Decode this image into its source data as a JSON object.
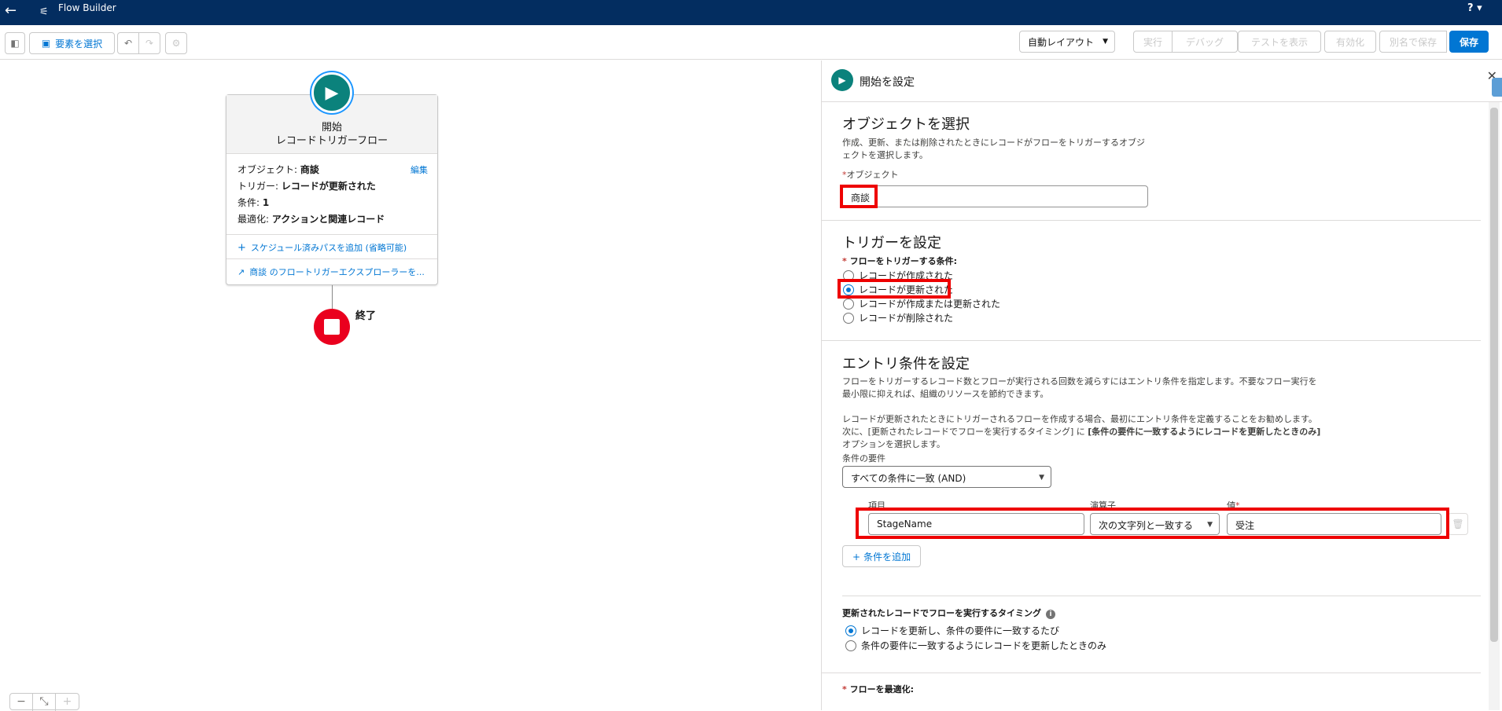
{
  "topbar": {
    "back_icon": "←",
    "title": "Flow Builder",
    "help": "? ▾"
  },
  "toolbar": {
    "select_elements": "要素を選択",
    "auto_layout": "自動レイアウト",
    "run": "実行",
    "debug": "デバッグ",
    "view_tests": "テストを表示",
    "activate": "有効化",
    "save_as": "別名で保存",
    "save": "保存"
  },
  "canvas": {
    "start_title": "開始",
    "start_subtitle": "レコードトリガーフロー",
    "object_label": "オブジェクト:",
    "object_value": "商談",
    "edit_link": "編集",
    "trigger_label": "トリガー:",
    "trigger_value": "レコードが更新された",
    "conditions_label": "条件:",
    "conditions_value": "1",
    "optimize_label": "最適化:",
    "optimize_value": "アクションと関連レコード",
    "add_scheduled_path": "スケジュール済みパスを追加 (省略可能)",
    "explorer_link": "商談 のフロートリガーエクスプローラーを...",
    "end_label": "終了"
  },
  "panel": {
    "title": "開始を設定",
    "object_section": {
      "heading": "オブジェクトを選択",
      "description_line1": "作成、更新、または削除されたときにレコードがフローをトリガーするオブジ",
      "description_line2": "ェクトを選択します。",
      "field_label": "オブジェクト",
      "field_value": "商談"
    },
    "trigger_section": {
      "heading": "トリガーを設定",
      "field_label": "フローをトリガーする条件:",
      "options": [
        "レコードが作成された",
        "レコードが更新された",
        "レコードが作成または更新された",
        "レコードが削除された"
      ],
      "selected_index": 1
    },
    "entry_section": {
      "heading": "エントリ条件を設定",
      "desc1": "フローをトリガーするレコード数とフローが実行される回数を減らすにはエントリ条件を指定します。不要なフロー実行を",
      "desc2": "最小限に抑えれば、組織のリソースを節約できます。",
      "desc3": "レコードが更新されたときにトリガーされるフローを作成する場合、最初にエントリ条件を定義することをお勧めします。",
      "desc4_prefix": "次に、[更新されたレコードでフローを実行するタイミング] に ",
      "desc4_bold": "[条件の要件に一致するようにレコードを更新したときのみ]",
      "desc5": "オプションを選択します。",
      "requirement_label": "条件の要件",
      "requirement_value": "すべての条件に一致 (AND)",
      "field_col": "項目",
      "operator_col": "演算子",
      "value_col": "値",
      "field_value": "StageName",
      "operator_value": "次の文字列と一致する",
      "value_value": "受注",
      "add_condition": "条件を追加"
    },
    "timing_section": {
      "heading": "更新されたレコードでフローを実行するタイミング",
      "info_icon": "i",
      "options": [
        "レコードを更新し、条件の要件に一致するたび",
        "条件の要件に一致するようにレコードを更新したときのみ"
      ],
      "selected_index": 0
    },
    "optimize_label": "フローを最適化:"
  }
}
